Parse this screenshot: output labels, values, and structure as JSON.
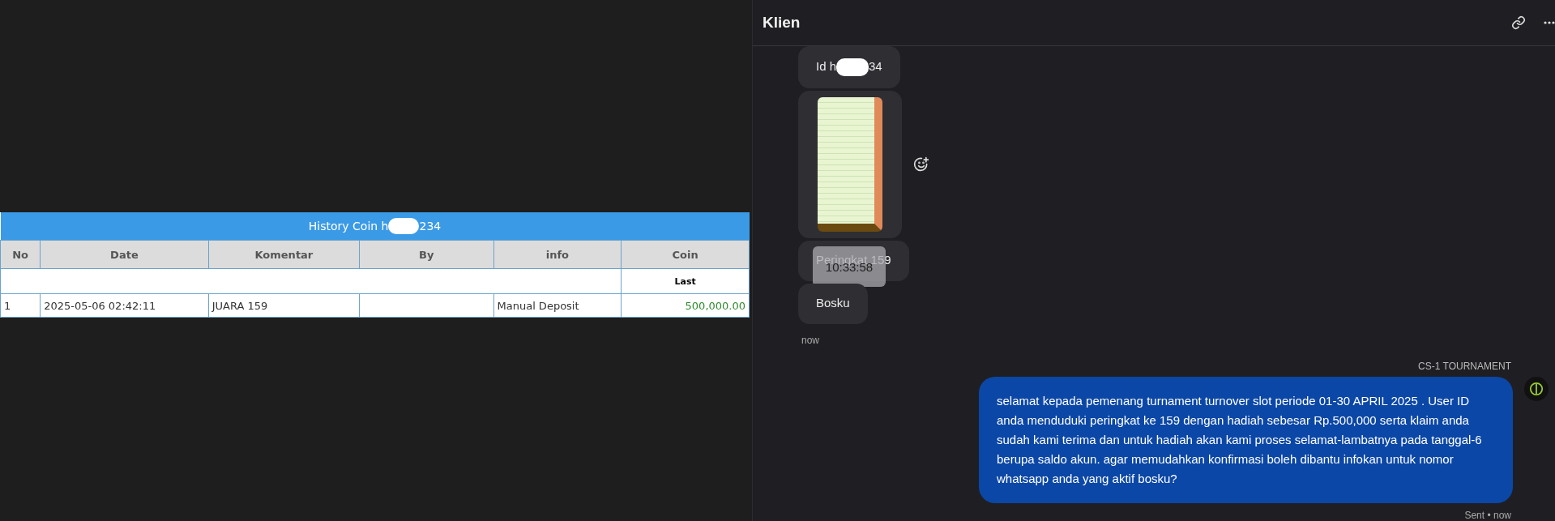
{
  "history_table": {
    "title_start": "History Coin h",
    "title_end": "234",
    "columns": [
      "No",
      "Date",
      "Komentar",
      "By",
      "info",
      "Coin"
    ],
    "subheader": "Last",
    "rows": [
      {
        "no": "1",
        "date": "2025-05-06 02:42:11",
        "komentar": "JUARA 159",
        "by": "",
        "info": "Manual Deposit",
        "coin": "500,000.00"
      }
    ]
  },
  "chat": {
    "title": "Klien",
    "incoming": [
      {
        "kind": "text",
        "text_start": "Id h",
        "text_end": "34",
        "redacted": true
      },
      {
        "kind": "image"
      },
      {
        "kind": "text",
        "text_start": "Peringkat 159",
        "tooltip": "10:33:58"
      },
      {
        "kind": "text",
        "text_start": "Bosku"
      }
    ],
    "incoming_time": "now",
    "outgoing": {
      "sender": "CS-1 TOURNAMENT",
      "text": "selamat kepada pemenang turnament turnover slot periode 01-30 APRIL 2025 . User ID anda menduduki peringkat ke 159 dengan hadiah sebesar Rp.500,000 serta klaim anda sudah kami terima dan untuk hadiah akan kami proses selamat-lambatnya pada tanggal-6 berupa saldo akun. agar memudahkan konfirmasi boleh dibantu infokan untuk nomor whatsapp anda yang aktif bosku?",
      "status": "Sent",
      "separator": "•",
      "time": "now"
    }
  }
}
